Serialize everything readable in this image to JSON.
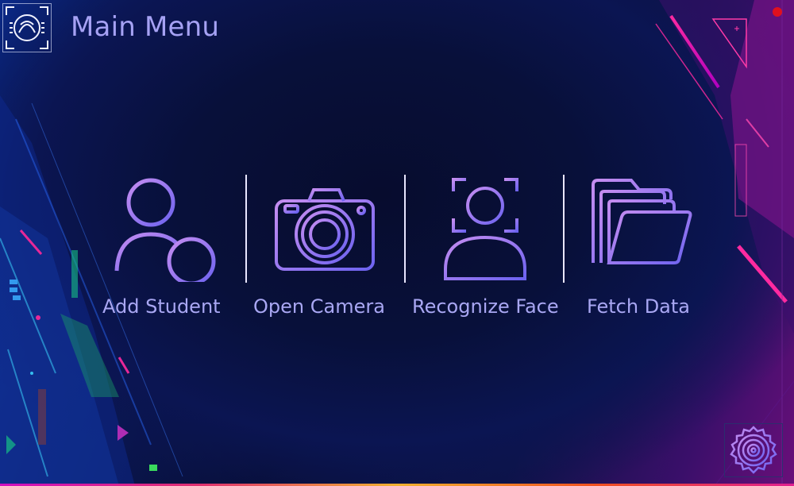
{
  "window": {
    "title": "Main Menu"
  },
  "menu": {
    "items": [
      {
        "label": "Add Student",
        "icon": "add-user-icon"
      },
      {
        "label": "Open Camera",
        "icon": "camera-icon"
      },
      {
        "label": "Recognize Face",
        "icon": "face-scan-icon"
      },
      {
        "label": "Fetch Data",
        "icon": "folder-icon"
      }
    ]
  },
  "colors": {
    "icon_gradient_start": "#c58df0",
    "icon_gradient_end": "#6d63f0",
    "label": "#a9a7f3",
    "title": "#a6a2f4",
    "close": "#e0101e"
  }
}
